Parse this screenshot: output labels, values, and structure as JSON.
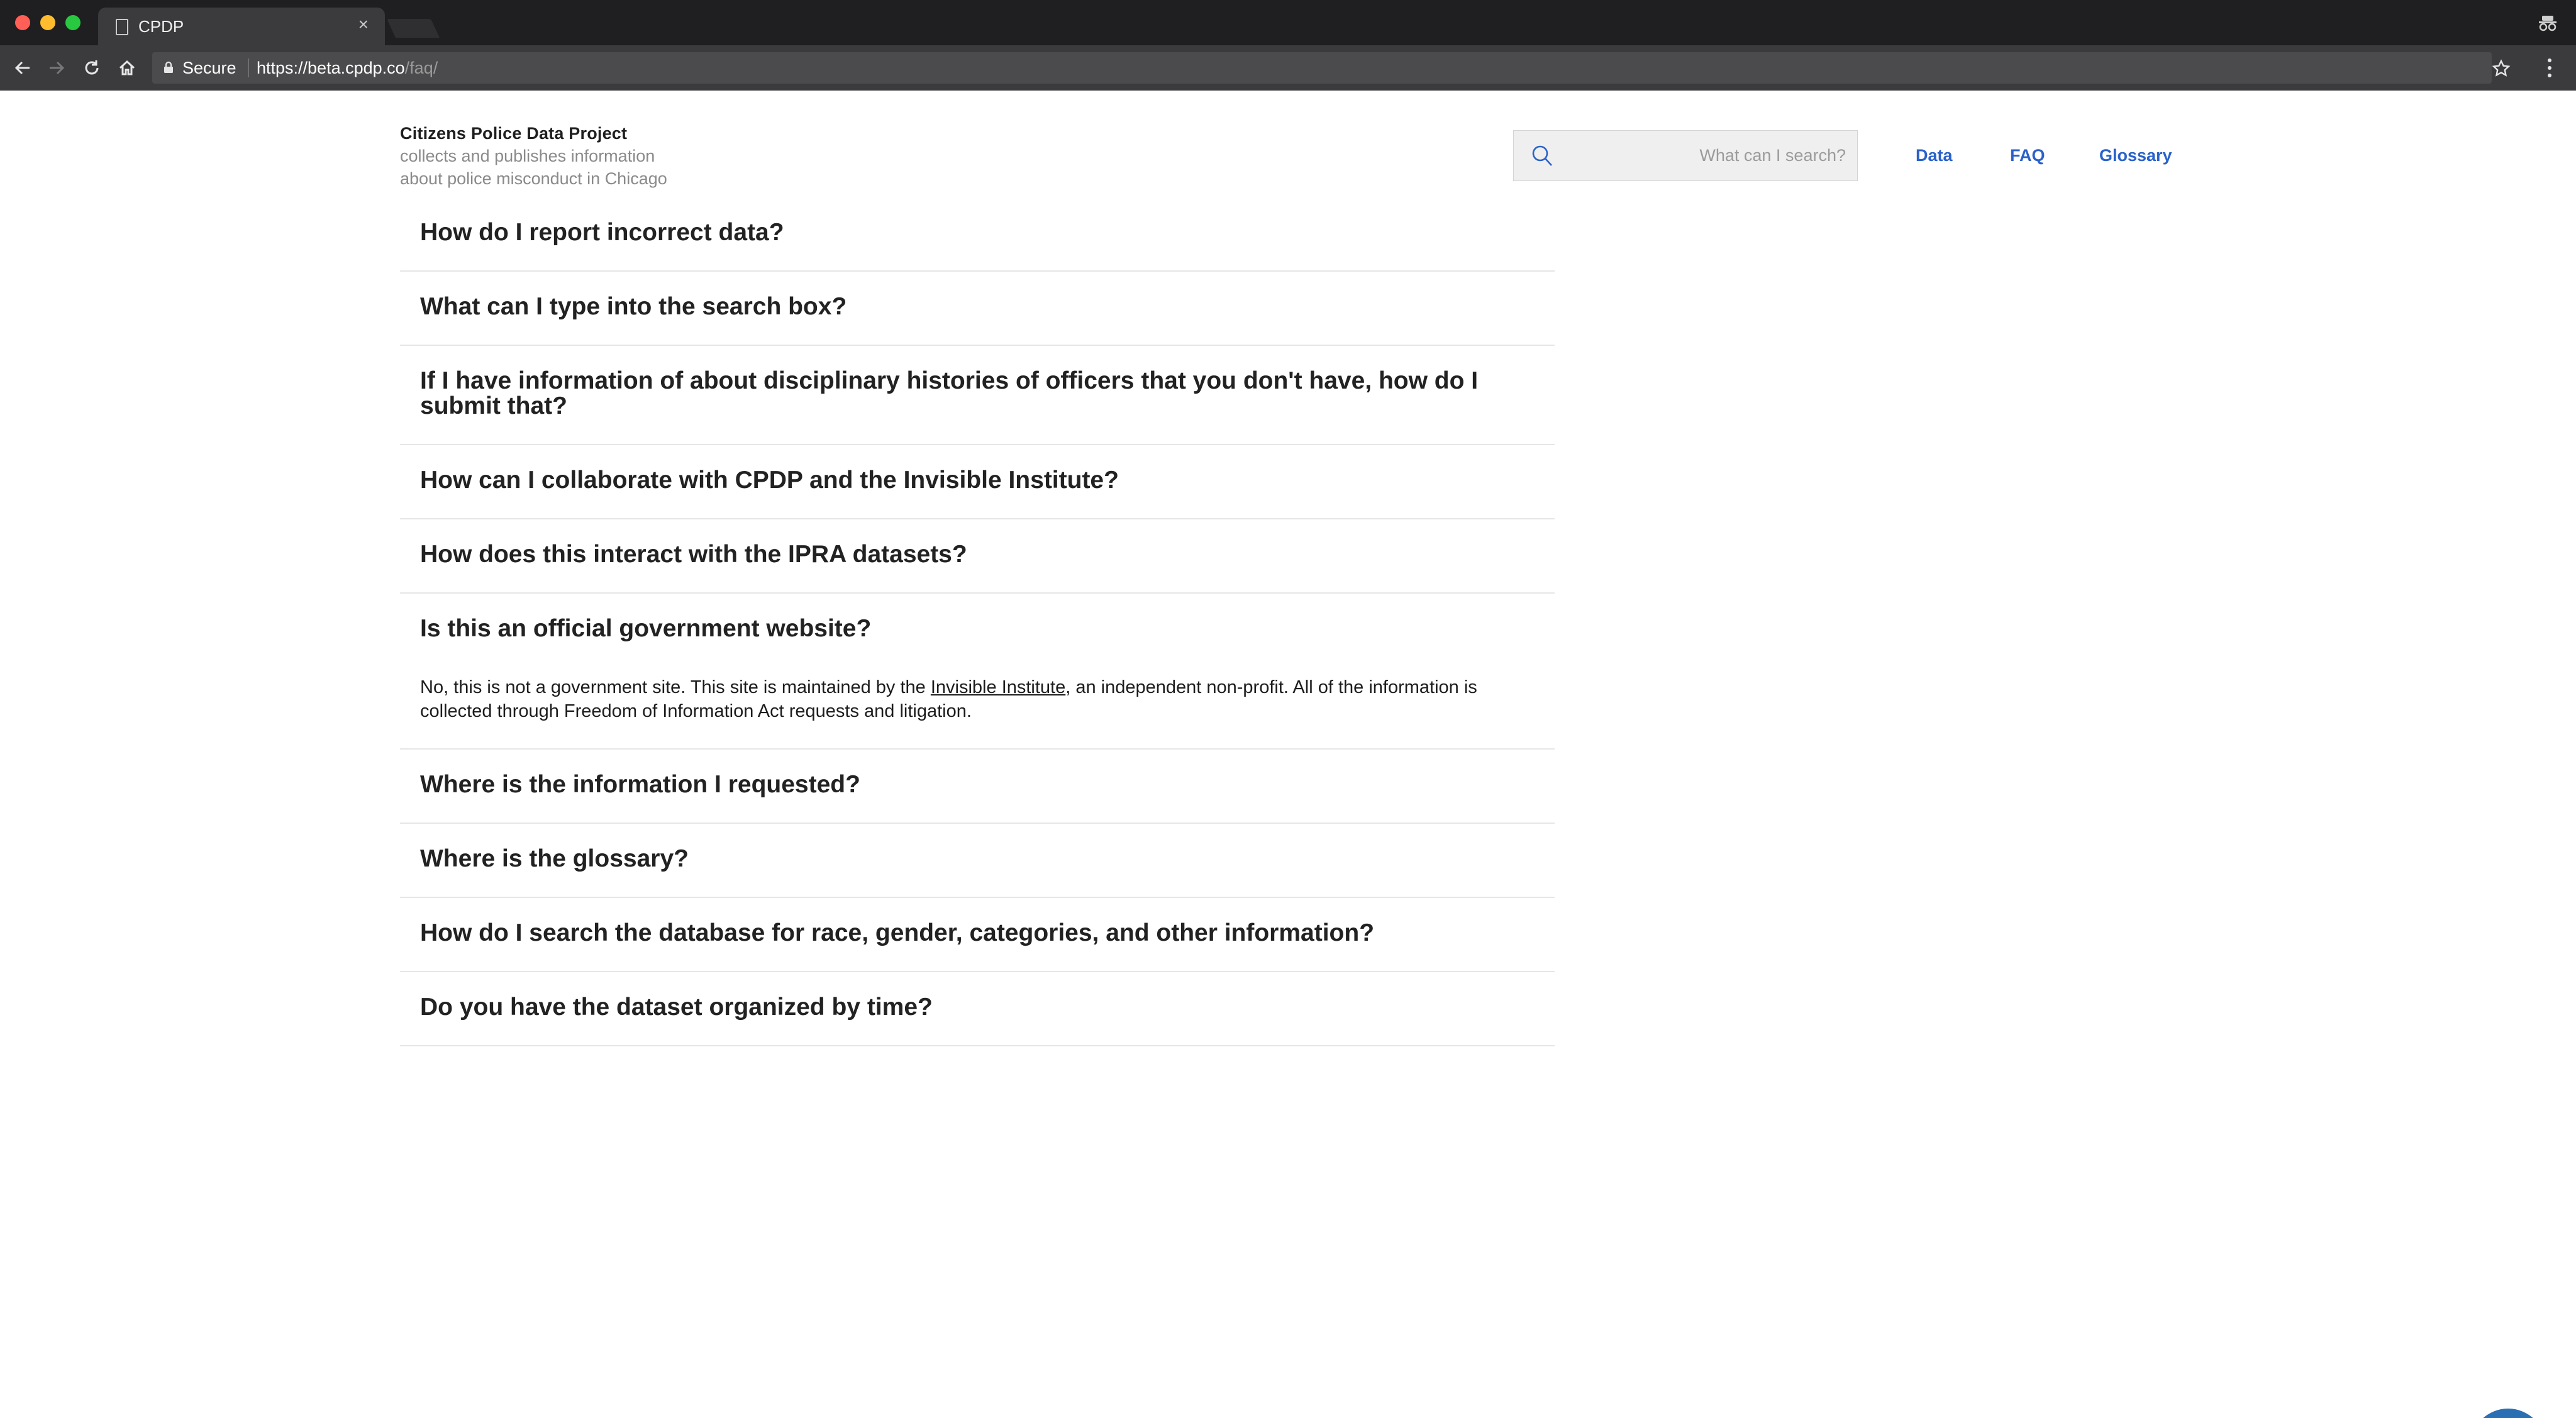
{
  "browser": {
    "tab_title": "CPDP",
    "secure_label": "Secure",
    "url_host": "https://beta.cpdp.co",
    "url_path": "/faq/"
  },
  "header": {
    "brand_title": "Citizens Police Data Project",
    "brand_desc_line1": "collects and publishes information",
    "brand_desc_line2": "about police misconduct in Chicago",
    "search_placeholder": "What can I search?",
    "nav": {
      "data": "Data",
      "faq": "FAQ",
      "glossary": "Glossary"
    }
  },
  "faq": [
    {
      "question": "How do I report incorrect data?"
    },
    {
      "question": "What can I type into the search box?"
    },
    {
      "question": "If I have information of about disciplinary histories of officers that you don't have, how do I submit that?"
    },
    {
      "question": "How can I collaborate with CPDP and the Invisible Institute?"
    },
    {
      "question": "How does this interact with the IPRA datasets?"
    },
    {
      "question": "Is this an official government website?",
      "answer_before_link": "No, this is not a government site. This site is maintained by the ",
      "answer_link": "Invisible Institute",
      "answer_after_link": ", an independent non-profit. All of the information is collected through Freedom of Information Act requests and litigation."
    },
    {
      "question": "Where is the information I requested?"
    },
    {
      "question": "Where is the glossary?"
    },
    {
      "question": "How do I search the database for race, gender, categories, and other information?"
    },
    {
      "question": "Do you have the dataset organized by time?"
    }
  ],
  "colors": {
    "nav_link": "#2a62c9",
    "chat_button": "#2a6fb4"
  },
  "icons": {
    "search": "search-icon",
    "chat": "chat-icon"
  }
}
